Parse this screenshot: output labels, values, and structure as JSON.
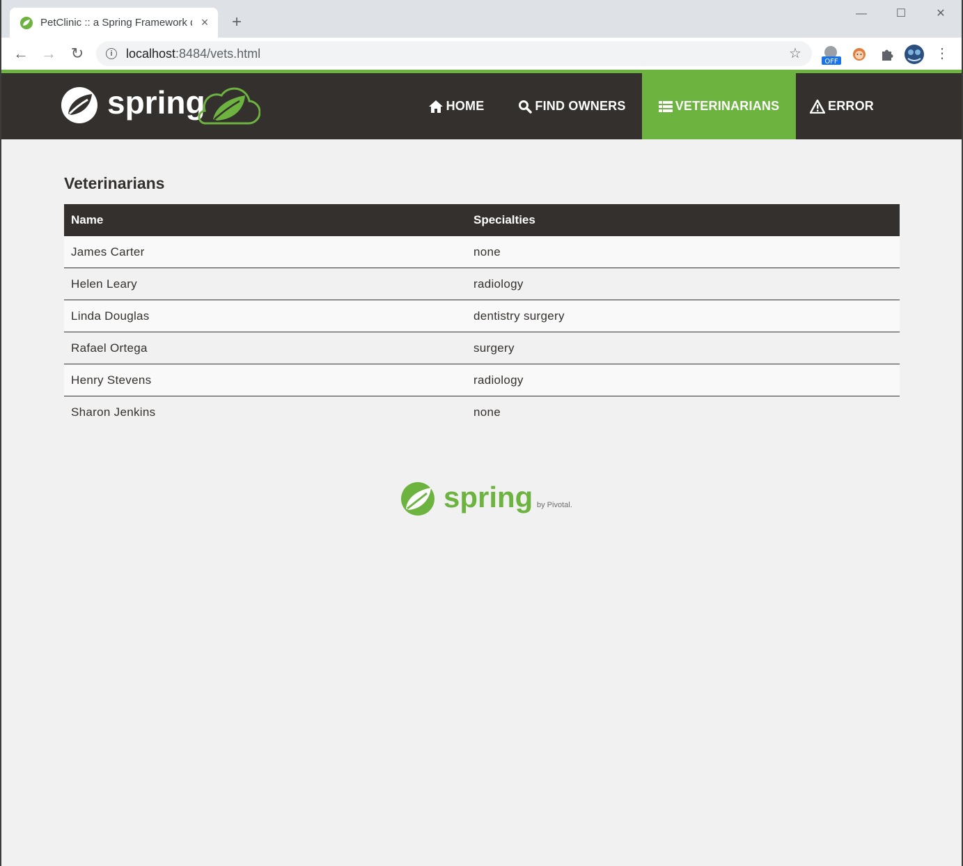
{
  "browser": {
    "tab_title": "PetClinic :: a Spring Framework demonstration",
    "new_tab": "+",
    "close_tab": "×",
    "url_host": "localhost",
    "url_path": ":8484/vets.html",
    "minimize": "—",
    "maximize": "☐",
    "close_window": "✕",
    "back": "←",
    "forward": "→",
    "reload": "↻",
    "bookmark": "☆",
    "extension_badge": "OFF"
  },
  "brand": {
    "name": "spring",
    "footer_name": "spring",
    "footer_by": "by Pivotal."
  },
  "nav": {
    "items": [
      {
        "label": "HOME",
        "icon": "home-icon"
      },
      {
        "label": "FIND OWNERS",
        "icon": "search-icon"
      },
      {
        "label": "VETERINARIANS",
        "icon": "list-icon",
        "active": true
      },
      {
        "label": "ERROR",
        "icon": "warning-icon"
      }
    ]
  },
  "page": {
    "title": "Veterinarians"
  },
  "table": {
    "headers": [
      "Name",
      "Specialties"
    ],
    "rows": [
      {
        "name": "James Carter",
        "specialties": "none"
      },
      {
        "name": "Helen Leary",
        "specialties": "radiology"
      },
      {
        "name": "Linda Douglas",
        "specialties": "dentistry surgery"
      },
      {
        "name": "Rafael Ortega",
        "specialties": "surgery"
      },
      {
        "name": "Henry Stevens",
        "specialties": "radiology"
      },
      {
        "name": "Sharon Jenkins",
        "specialties": "none"
      }
    ]
  },
  "colors": {
    "spring_green": "#6db33f",
    "navbar_dark": "#34302d",
    "page_bg": "#f1f1f1"
  }
}
